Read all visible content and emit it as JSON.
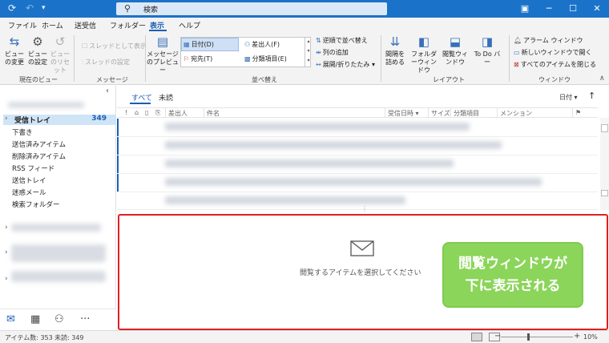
{
  "titlebar": {
    "search_placeholder": "検索",
    "icons": [
      "sync-icon",
      "undo-icon",
      "dropdown-icon"
    ],
    "window_buttons": [
      "ribbon-display-options-icon",
      "minimize-icon",
      "maximize-icon",
      "close-icon"
    ]
  },
  "tabs": [
    "ファイル",
    "ホーム",
    "送受信",
    "フォルダー",
    "表示",
    "ヘルプ"
  ],
  "active_tab": "表示",
  "ribbon": {
    "current_view": {
      "change_view": "ビューの変更",
      "view_settings": "ビューの設定",
      "reset_view": "ビューのリセット",
      "group_label": "現在のビュー"
    },
    "messages": {
      "show_as_thread": "スレッドとして表示",
      "thread_settings": "スレッドの設定",
      "group_label": "メッセージ"
    },
    "arrangement": {
      "message_preview": "メッセージのプレビュー",
      "date": "日付(D)",
      "from": "差出人(F)",
      "to": "宛先(T)",
      "categories": "分類項目(E)",
      "reverse_sort": "逆順で並べ替え",
      "add_columns": "列の追加",
      "expand_collapse": "展開/折りたたみ",
      "group_label": "並べ替え"
    },
    "layout": {
      "conversation_spacing": "間隔を詰める",
      "folder_pane": "フォルダーウィンドウ",
      "reading_pane": "閲覧ウィンドウ",
      "todo_bar": "To Do バー",
      "group_label": "レイアウト"
    },
    "window": {
      "reminders": "アラーム ウィンドウ",
      "open_new_window": "新しいウィンドウで開く",
      "close_all_items": "すべてのアイテムを閉じる",
      "group_label": "ウィンドウ"
    }
  },
  "folders": {
    "inbox": "受信トレイ",
    "inbox_count": "349",
    "items": [
      "下書き",
      "送信済みアイテム",
      "削除済みアイテム",
      "RSS フィード",
      "送信トレイ",
      "迷惑メール",
      "検索フォルダー"
    ]
  },
  "message_list": {
    "tab_all": "すべて",
    "tab_unread": "未読",
    "sort_label": "日付",
    "columns": {
      "from": "差出人",
      "subject": "件名",
      "received": "受信日時",
      "size": "サイズ",
      "category": "分類項目",
      "mention": "メンション"
    }
  },
  "reading_pane": {
    "empty_text": "閲覧するアイテムを選択してください"
  },
  "callout": {
    "line1": "閲覧ウィンドウが",
    "line2": "下に表示される",
    "color": "#8bd55a"
  },
  "highlight_color": "#e02020",
  "statusbar": {
    "item_count": "アイテム数: 353",
    "unread_count": "未読: 349",
    "zoom": "10%"
  }
}
